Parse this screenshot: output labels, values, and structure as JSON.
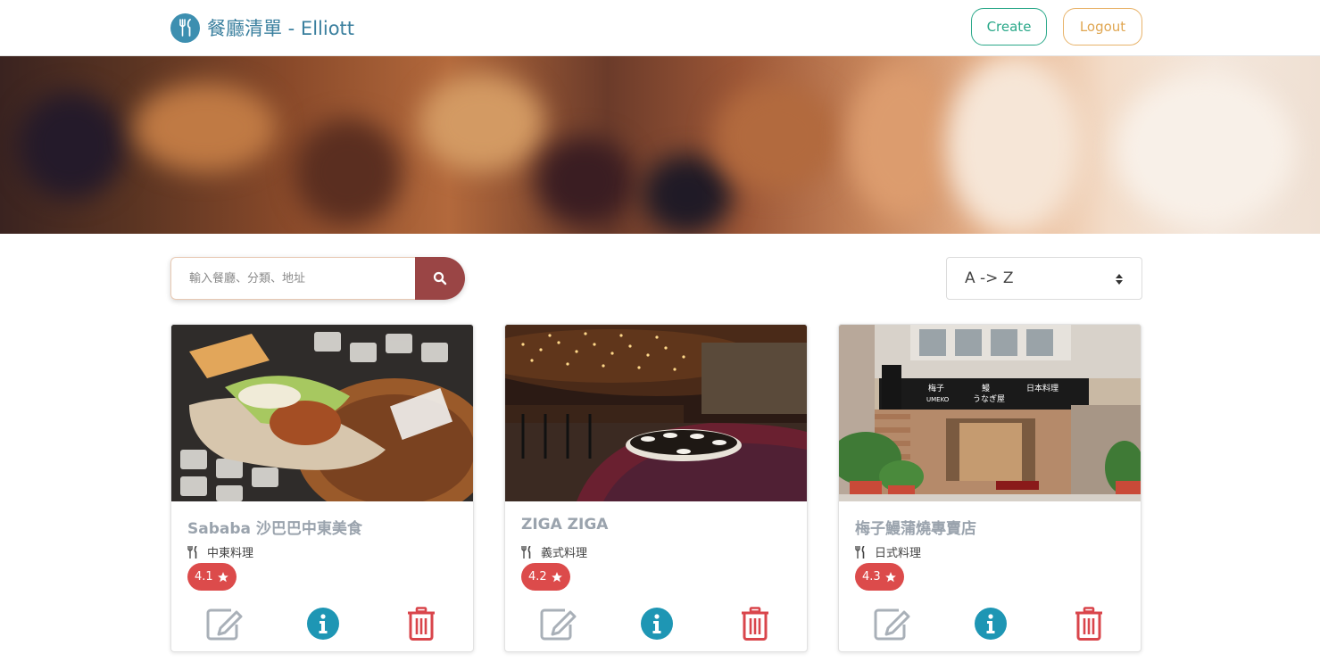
{
  "header": {
    "brand_title": "餐廳清單 - Elliott",
    "logo_icon": "utensils-icon",
    "create_label": "Create",
    "logout_label": "Logout"
  },
  "colors": {
    "brand": "#3d8fb0",
    "create": "#2aa889",
    "logout": "#e0a651",
    "search_button": "#9a4545",
    "rating_badge": "#dc4b4b",
    "info": "#1e96b4",
    "delete": "#d9454b",
    "edit": "#a9b0b8"
  },
  "search": {
    "placeholder": "輸入餐廳、分類、地址",
    "value": "",
    "button_icon": "search-icon"
  },
  "sort": {
    "selected": "A -> Z",
    "icon": "sort-arrows-icon"
  },
  "restaurants": [
    {
      "name": "Sababa 沙巴巴中東美食",
      "category": "中東料理",
      "rating": "4.1"
    },
    {
      "name": "ZIGA ZIGA",
      "category": "義式料理",
      "rating": "4.2"
    },
    {
      "name": "梅子鰻蒲燒專賣店",
      "category": "日式料理",
      "rating": "4.3"
    }
  ],
  "card_actions": [
    "edit-icon",
    "info-icon",
    "trash-icon"
  ]
}
